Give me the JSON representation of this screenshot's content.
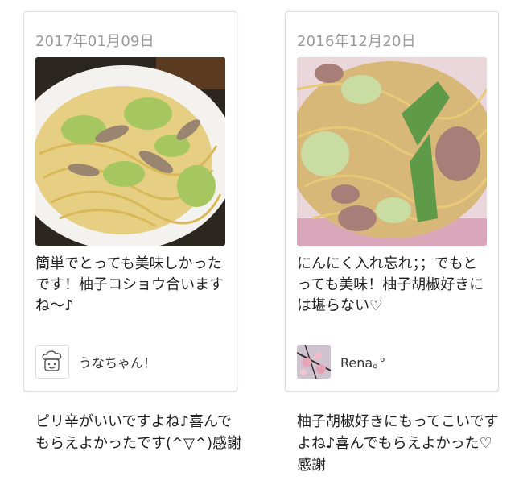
{
  "cards": [
    {
      "date": "2017年01月09日",
      "comment": "簡単でとっても美味しかったです！柚子コショウ合いますね～♪",
      "author": "うなちゃん！",
      "avatar_icon": "chef-hat-face-icon",
      "reply": "ピリ辛がいいですよね♪喜んでもらえよかったです(^▽^)感謝"
    },
    {
      "date": "2016年12月20日",
      "comment": "にんにく入れ忘れ；；でもとっても美味！柚子胡椒好きには堪らない♡",
      "author": "Rena｡°",
      "avatar_icon": "cherry-blossom-photo-icon",
      "reply": "柚子胡椒好きにもってこいですよね♪喜んでもらえよかった♡感謝"
    }
  ]
}
